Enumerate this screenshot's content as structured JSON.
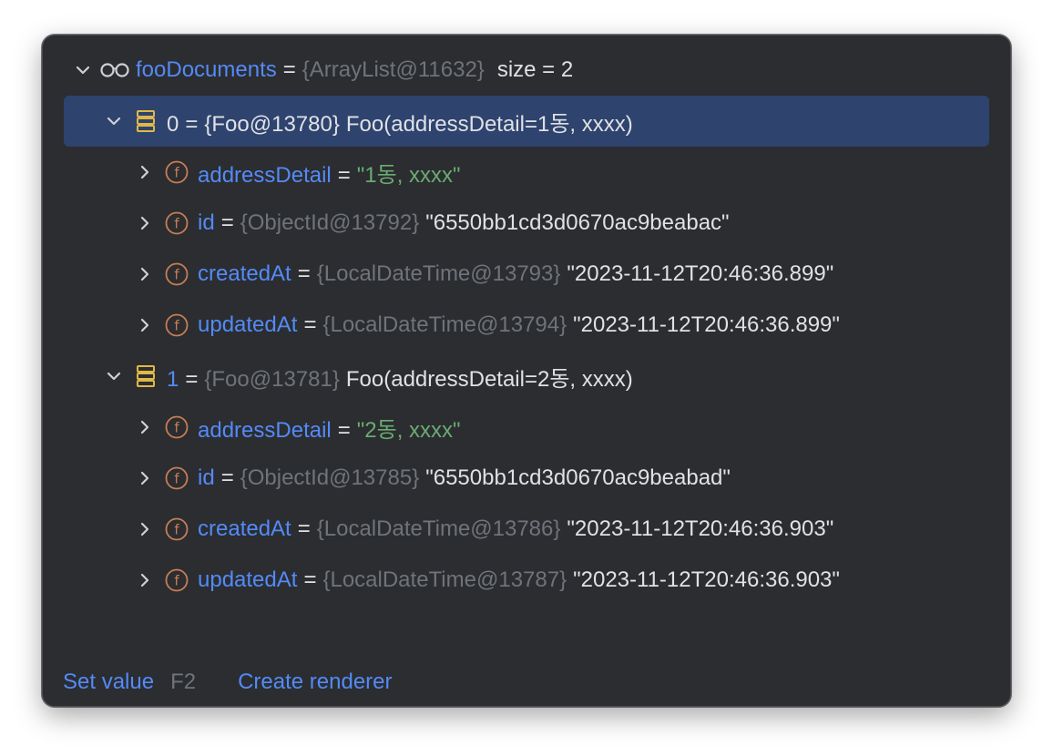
{
  "tree": {
    "root": {
      "name": "fooDocuments",
      "eq": "=",
      "type": "{ArrayList@11632}",
      "size": "size = 2"
    },
    "items": [
      {
        "index": "0",
        "eq": "=",
        "type": "{Foo@13780}",
        "value": "Foo(addressDetail=1동, xxxx)",
        "fields": [
          {
            "name": "addressDetail",
            "eq": "=",
            "type": "",
            "value": "\"1동, xxxx\""
          },
          {
            "name": "id",
            "eq": "=",
            "type": "{ObjectId@13792}",
            "value": "\"6550bb1cd3d0670ac9beabac\""
          },
          {
            "name": "createdAt",
            "eq": "=",
            "type": "{LocalDateTime@13793}",
            "value": "\"2023-11-12T20:46:36.899\""
          },
          {
            "name": "updatedAt",
            "eq": "=",
            "type": "{LocalDateTime@13794}",
            "value": "\"2023-11-12T20:46:36.899\""
          }
        ]
      },
      {
        "index": "1",
        "eq": "=",
        "type": "{Foo@13781}",
        "value": "Foo(addressDetail=2동, xxxx)",
        "fields": [
          {
            "name": "addressDetail",
            "eq": "=",
            "type": "",
            "value": "\"2동, xxxx\""
          },
          {
            "name": "id",
            "eq": "=",
            "type": "{ObjectId@13785}",
            "value": "\"6550bb1cd3d0670ac9beabad\""
          },
          {
            "name": "createdAt",
            "eq": "=",
            "type": "{LocalDateTime@13786}",
            "value": "\"2023-11-12T20:46:36.903\""
          },
          {
            "name": "updatedAt",
            "eq": "=",
            "type": "{LocalDateTime@13787}",
            "value": "\"2023-11-12T20:46:36.903\""
          }
        ]
      }
    ]
  },
  "footer": {
    "set_value": "Set value",
    "set_value_shortcut": "F2",
    "create_renderer": "Create renderer"
  },
  "colors": {
    "background": "#2b2d30",
    "selection": "#2e436e",
    "name": "#548af7",
    "type": "#6f737a",
    "string": "#6aab73",
    "field_icon": "#c77d55",
    "array_icon": "#e0b847"
  },
  "icons": {
    "root": "watch-glasses-icon",
    "element": "array-element-icon",
    "field": "field-f-icon",
    "expanded": "chevron-down-icon",
    "collapsed": "chevron-right-icon"
  }
}
